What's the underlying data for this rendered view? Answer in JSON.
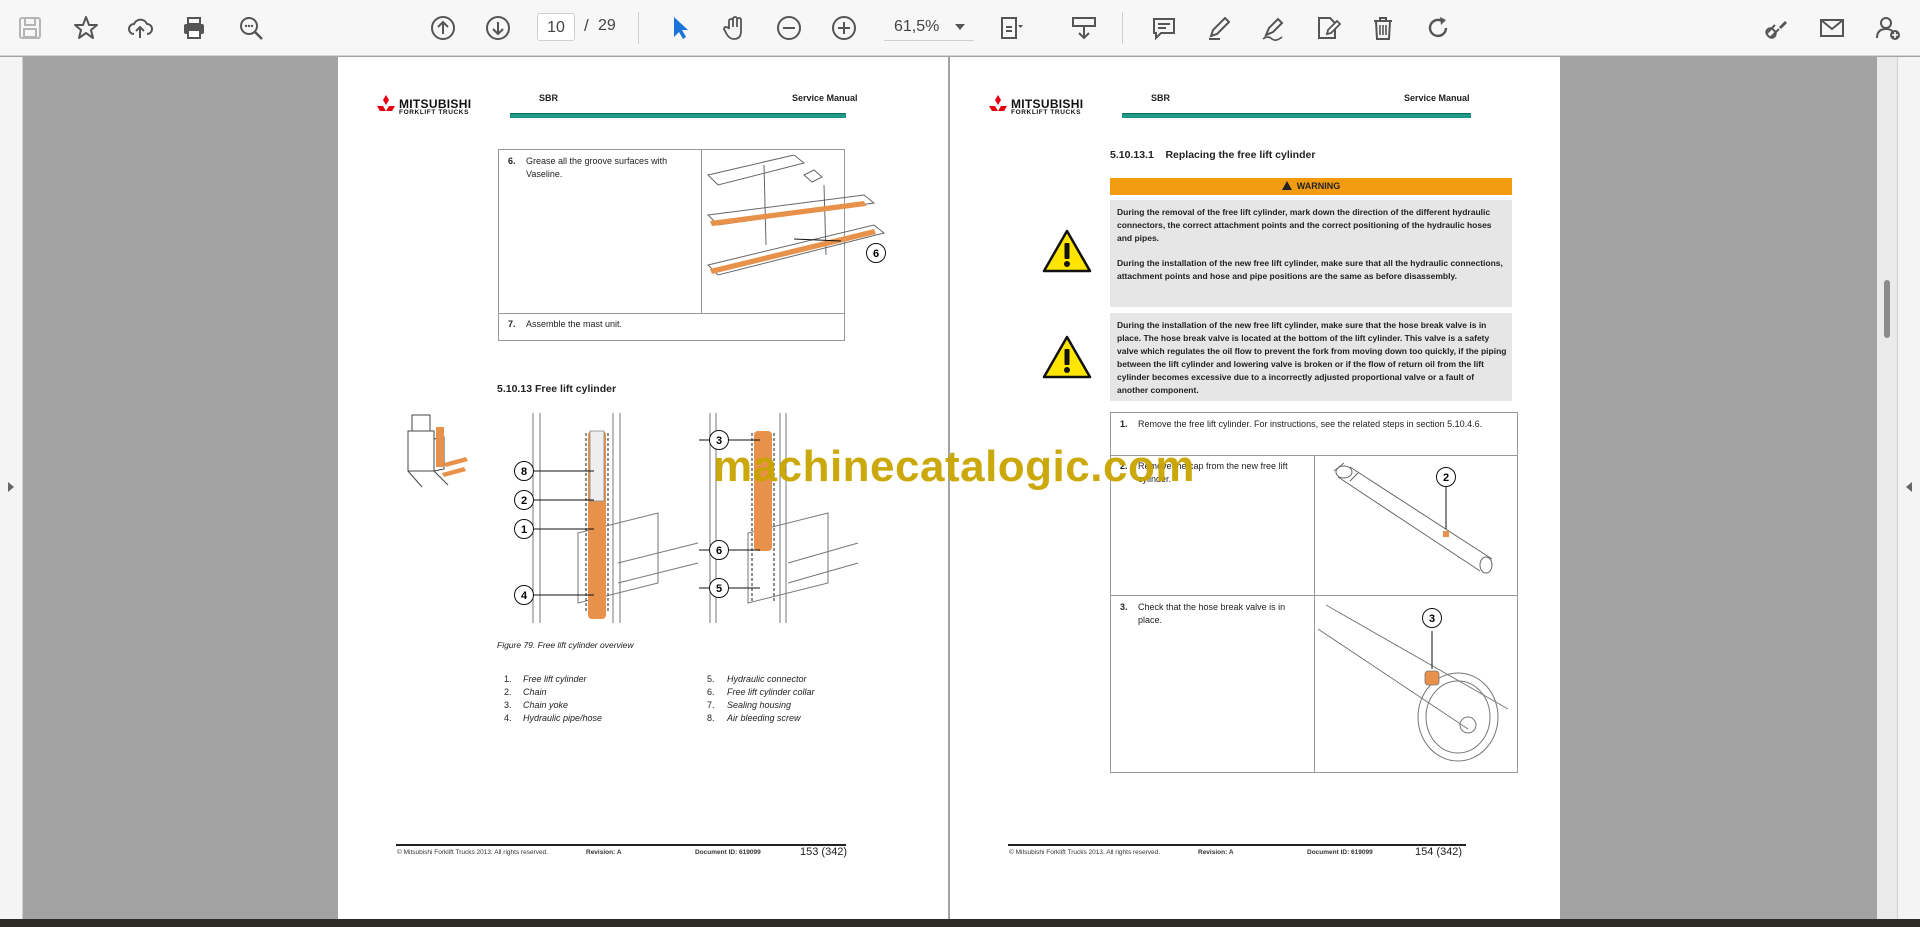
{
  "toolbar": {
    "current_page": "10",
    "page_separator": "/",
    "total_pages": "29",
    "zoom": "61,5%"
  },
  "left_page": {
    "header_brand": "MITSUBISHI",
    "header_brand_sub": "FORKLIFT TRUCKS",
    "header_code": "SBR",
    "header_title": "Service Manual",
    "step6_num": "6.",
    "step6_text": "Grease all the groove surfaces with Vaseline.",
    "step6_callout": "6",
    "step7_num": "7.",
    "step7_text": "Assemble the mast unit.",
    "section_title": "5.10.13  Free lift cylinder",
    "callouts_left": [
      "8",
      "2",
      "1",
      "4"
    ],
    "callouts_right": [
      "3",
      "6",
      "5"
    ],
    "figure_caption": "Figure 79. Free lift cylinder overview",
    "legend": [
      {
        "num": "1.",
        "label": "Free lift cylinder"
      },
      {
        "num": "2.",
        "label": "Chain"
      },
      {
        "num": "3.",
        "label": "Chain yoke"
      },
      {
        "num": "4.",
        "label": "Hydraulic pipe/hose"
      },
      {
        "num": "5.",
        "label": "Hydraulic connector"
      },
      {
        "num": "6.",
        "label": "Free lift cylinder collar"
      },
      {
        "num": "7.",
        "label": "Sealing housing"
      },
      {
        "num": "8.",
        "label": "Air bleeding screw"
      }
    ],
    "footer_copyright": "© Mitsubishi Forklift Trucks 2013. All rights reserved.",
    "footer_revision": "Revision: A",
    "footer_docid": "Document ID: 619099",
    "footer_page": "153 (342)"
  },
  "right_page": {
    "header_brand": "MITSUBISHI",
    "header_brand_sub": "FORKLIFT TRUCKS",
    "header_code": "SBR",
    "header_title": "Service Manual",
    "section_title": "5.10.13.1    Replacing the free lift cylinder",
    "warning_label": "WARNING",
    "warning_p1": "During the removal of the free lift cylinder, mark down the direction of the different hydraulic connectors, the correct attachment points and the correct positioning of the hydraulic hoses and pipes.",
    "warning_p2": "During the installation of the new free lift cylinder, make sure that all the hydraulic connections, attachment points and hose and pipe positions are the same as before disassembly.",
    "warning_p3": "During the installation of the new free lift cylinder, make sure that the hose break valve is in place. The hose break valve is located at the bottom of the lift cylinder. This valve is a safety valve which regulates the oil flow to prevent the fork from moving down too quickly, if the piping between the lift cylinder and lowering valve is broken or if the flow of return oil from the lift cylinder becomes excessive due to a incorrectly adjusted proportional valve or a fault of another component.",
    "step1_num": "1.",
    "step1_text": "Remove the free lift cylinder. For instructions, see the related steps in section 5.10.4.6.",
    "step2_num": "2.",
    "step2_text": "Remove the cap from the new free lift cylinder.",
    "step2_callout": "2",
    "step3_num": "3.",
    "step3_text": "Check that the hose break valve is in place.",
    "step3_callout": "3",
    "footer_copyright": "© Mitsubishi Forklift Trucks 2013. All rights reserved.",
    "footer_revision": "Revision: A",
    "footer_docid": "Document ID: 619099",
    "footer_page": "154 (342)"
  },
  "watermark": "machinecatalogic.com",
  "colors": {
    "accent_green": "#1e9a86",
    "warning_orange": "#f39c12",
    "logo_red": "#e60012",
    "part_orange": "#e8914a"
  }
}
